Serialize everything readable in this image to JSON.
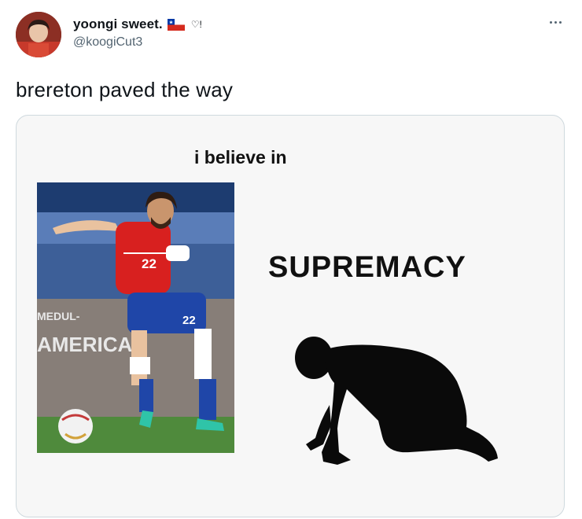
{
  "tweet": {
    "display_name": "yoongi sweet.",
    "badge_text": "♡!",
    "handle": "@koogiCut3",
    "text": "brereton paved the way",
    "more_icon": "more-horizontal-icon"
  },
  "media": {
    "caption_top": "i believe in",
    "caption_big": "SUPREMACY",
    "photo_alt": "soccer player",
    "jersey_number": "22"
  }
}
